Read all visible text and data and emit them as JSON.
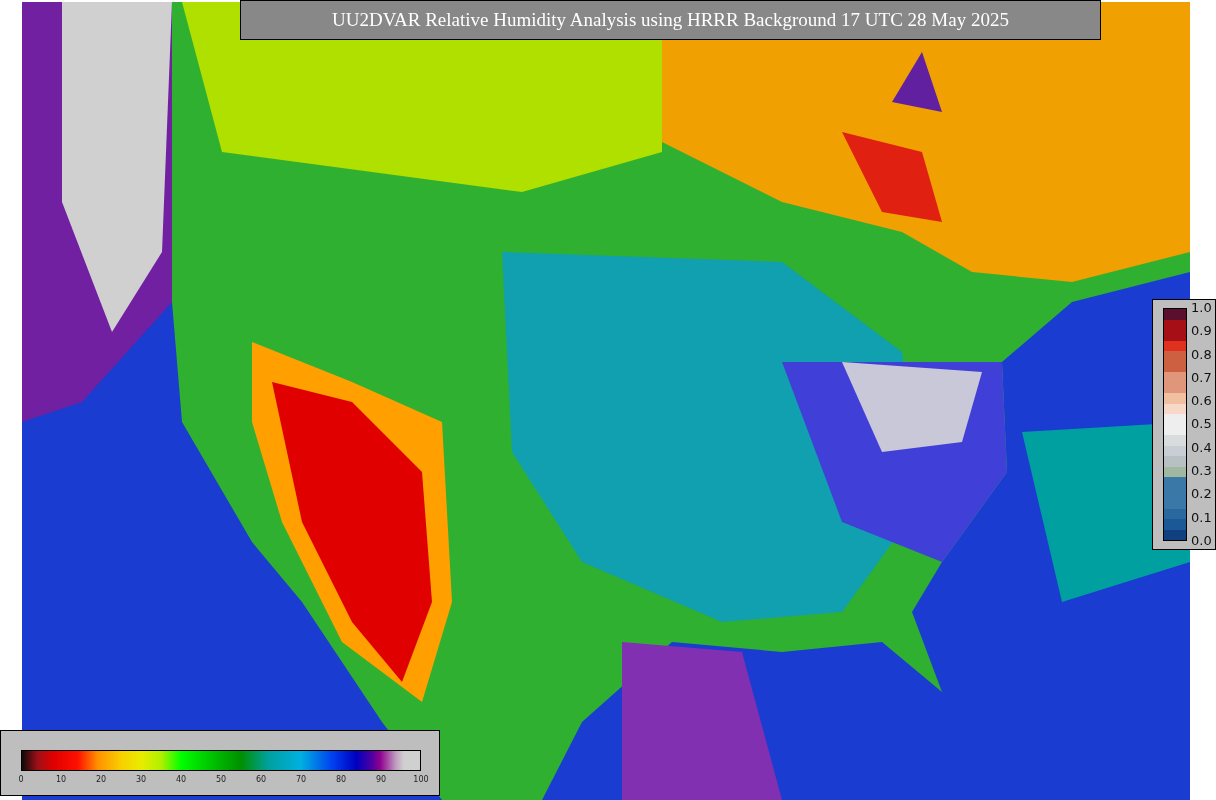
{
  "title": "UU2DVAR Relative Humidity Analysis using HRRR Background 17 UTC 28 May 2025",
  "weight_legend": {
    "ticks": [
      "1.0",
      "0.9",
      "0.8",
      "0.7",
      "0.6",
      "0.5",
      "0.4",
      "0.3",
      "0.2",
      "0.1",
      "0.0"
    ]
  },
  "humidity_legend": {
    "ticks": [
      "0",
      "10",
      "20",
      "30",
      "40",
      "50",
      "60",
      "70",
      "80",
      "90",
      "100"
    ]
  }
}
